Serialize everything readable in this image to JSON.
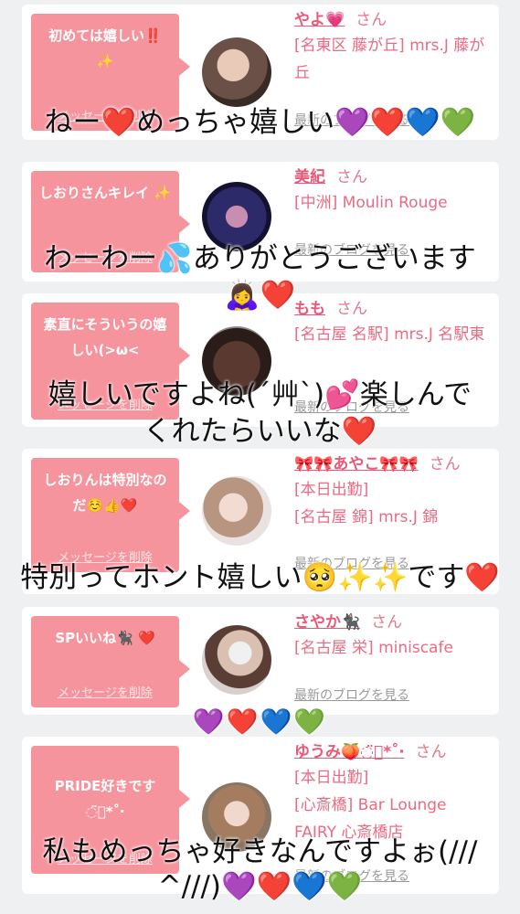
{
  "cards": [
    {
      "message": "初めては嬉しい‼️ ✨",
      "delete_label": "メッセージを削除",
      "name": "やよ💗",
      "honorific": "さん",
      "shop": "[名東区 藤が丘] mrs.J 藤が丘",
      "blog": "最新のブログを見る"
    },
    {
      "message": "しおりさんキレイ ✨",
      "delete_label": "メッセージを削除",
      "name": "美紀",
      "honorific": "さん",
      "shop": "[中洲] Moulin Rouge",
      "blog": "最新のブログを見る"
    },
    {
      "message": "素直にそういうの嬉しい(>ω<",
      "delete_label": "メッセージを削除",
      "name": "もも",
      "honorific": "さん",
      "shop": "[名古屋 名駅] mrs.J 名駅東",
      "blog": "最新のブログを見る"
    },
    {
      "message": "しおりんは特別なのだ☺️👍❤️",
      "delete_label": "メッセージを削除",
      "name": "🎀🎀あやこ🎀🎀",
      "honorific": "さん",
      "status": "[本日出勤]",
      "shop": "[名古屋 錦] mrs.J 錦",
      "blog": "最新のブログを見る"
    },
    {
      "message": "SPいいね🐈‍⬛ ❤️",
      "delete_label": "メッセージを削除",
      "name": "さやか🐈‍⬛",
      "honorific": "さん",
      "shop": "[名古屋 栄] miniscafe",
      "blog": "最新のブログを見る"
    },
    {
      "message": "PRIDE好きです ◌̈⃝*˚‧",
      "delete_label": "メッセージを削除",
      "name": "ゆうみ🍑◌̈⃝*˚‧",
      "honorific": "さん",
      "status": "[本日出勤]",
      "shop": "[心斎橋] Bar Lounge FAIRY 心斎橋店",
      "blog": "最新のブログを見る"
    }
  ],
  "overlays": {
    "o1": "ねー❤️めっちゃ嬉しい💜❤️💙💚",
    "o2a": "わーわー💦ありがとうございます",
    "o2b": "🙇‍♀️❤️",
    "o3a": "嬉しいですよね(´艸`)💕楽しんで",
    "o3b": "くれたらいいな❤️",
    "o4": "特別ってホント嬉しい🥺✨✨です❤️",
    "o5": "💜❤️💙💚",
    "o6a": "私もめっちゃ好きなんですよぉ(///",
    "o6b": "^///)💜❤️💙💚"
  },
  "colors": {
    "bubble": "#f6949e",
    "name": "#e85a79",
    "shop": "#ea6b82",
    "background": "#eef0f2"
  }
}
